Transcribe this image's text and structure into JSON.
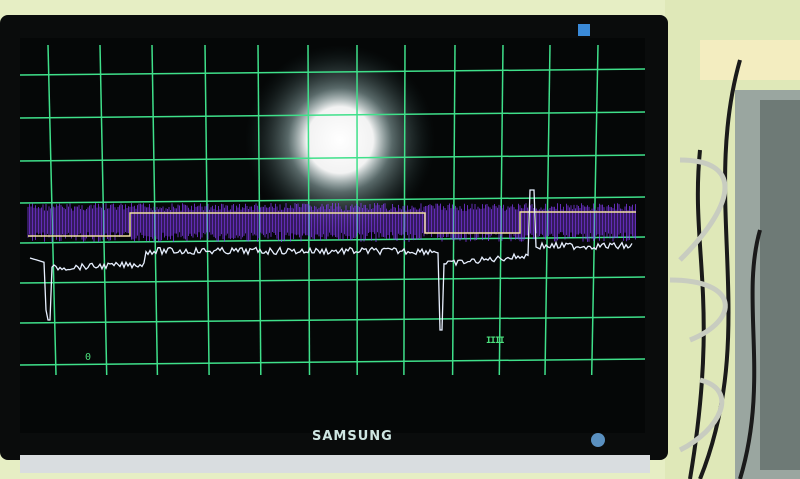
{
  "monitor": {
    "brand": "SAMSUNG"
  },
  "scope": {
    "marker_left": "0",
    "marker_right": "IIII",
    "colors": {
      "grid": "#3fe08a",
      "noise_band": "#8a3cff",
      "square_wave": "#f0e0a0",
      "signal": "#e8f0ff"
    }
  }
}
